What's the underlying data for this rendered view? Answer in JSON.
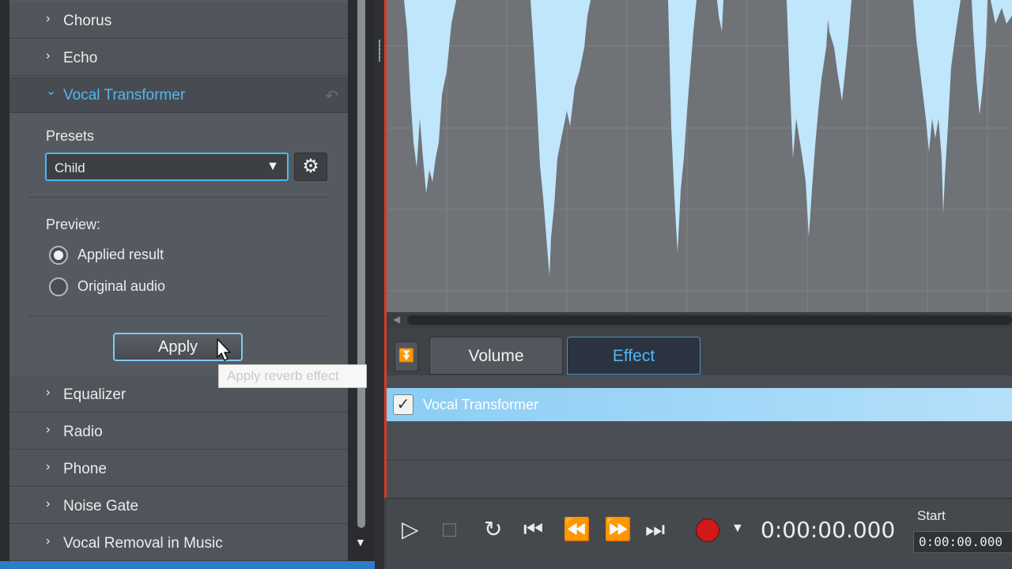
{
  "effects_panel": {
    "effects_above": [
      {
        "label": "Chorus"
      },
      {
        "label": "Echo"
      }
    ],
    "expanded_effect": {
      "label": "Vocal Transformer",
      "presets_label": "Presets",
      "preset_value": "Child",
      "preview_label": "Preview:",
      "preview_options": [
        {
          "label": "Applied result",
          "selected": true
        },
        {
          "label": "Original audio",
          "selected": false
        }
      ],
      "apply_label": "Apply",
      "apply_tooltip": "Apply reverb effect"
    },
    "effects_below": [
      {
        "label": "Equalizer"
      },
      {
        "label": "Radio"
      },
      {
        "label": "Phone"
      },
      {
        "label": "Noise Gate"
      },
      {
        "label": "Vocal Removal in Music"
      }
    ]
  },
  "tabs": [
    {
      "label": "Volume",
      "active": false
    },
    {
      "label": "Effect",
      "active": true
    }
  ],
  "effect_list": [
    {
      "label": "Vocal Transformer",
      "checked": true,
      "selected": true
    }
  ],
  "transport": {
    "time": "0:00:00.000",
    "start_label": "Start",
    "start_value": "0:00:00.000"
  },
  "icons": {
    "chevron_right": "›",
    "chevron_down": "⌄",
    "reset": "↶",
    "dropdown": "▼",
    "gear": "⚙",
    "play": "▷",
    "stop": "□",
    "loop": "↻",
    "skip_start": "⏮",
    "rewind": "⏪",
    "fast_forward": "⏩",
    "skip_end": "⏭",
    "check": "✓",
    "collapse": "⏬"
  },
  "colors": {
    "accent": "#4fb7f2",
    "waveform": "#bfe6fb",
    "record": "#d21818",
    "playhead": "#d93a24"
  }
}
